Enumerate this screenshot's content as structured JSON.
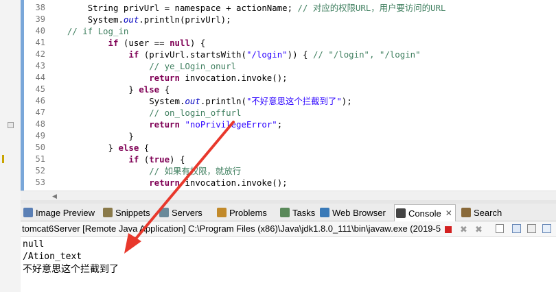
{
  "editor": {
    "line_numbers": [
      "38",
      "39",
      "40",
      "41",
      "42",
      "43",
      "44",
      "45",
      "46",
      "47",
      "48",
      "49",
      "50",
      "51",
      "52",
      "53"
    ],
    "lines": [
      {
        "indent": "        ",
        "parts": [
          [
            "n",
            "String privUrl = namespace + actionName; "
          ],
          [
            "cm",
            "// 对应的权限URL，用户要访问的URL"
          ]
        ]
      },
      {
        "indent": "        ",
        "parts": [
          [
            "n",
            "System."
          ],
          [
            "it",
            "out"
          ],
          [
            "n",
            ".println(privUrl);"
          ]
        ]
      },
      {
        "indent": "    ",
        "parts": [
          [
            "cm",
            "// if Log_in"
          ]
        ]
      },
      {
        "indent": "            ",
        "parts": [
          [
            "kw",
            "if"
          ],
          [
            "n",
            " (user == "
          ],
          [
            "kw",
            "null"
          ],
          [
            "n",
            ") {"
          ]
        ]
      },
      {
        "indent": "                ",
        "parts": [
          [
            "kw",
            "if"
          ],
          [
            "n",
            " (privUrl.startsWith("
          ],
          [
            "st",
            "\"/login\""
          ],
          [
            "n",
            ")) { "
          ],
          [
            "cm",
            "// \"/login\", \"/login\""
          ]
        ]
      },
      {
        "indent": "                    ",
        "parts": [
          [
            "cm",
            "// ye_LOgin_onurl"
          ]
        ]
      },
      {
        "indent": "                    ",
        "parts": [
          [
            "kw",
            "return"
          ],
          [
            "n",
            " invocation.invoke();"
          ]
        ]
      },
      {
        "indent": "                ",
        "parts": [
          [
            "n",
            "} "
          ],
          [
            "kw",
            "else"
          ],
          [
            "n",
            " {"
          ]
        ]
      },
      {
        "indent": "                    ",
        "parts": [
          [
            "n",
            "System."
          ],
          [
            "it",
            "out"
          ],
          [
            "n",
            ".println("
          ],
          [
            "st",
            "\"不好意思这个拦截到了\""
          ],
          [
            "n",
            ");"
          ]
        ]
      },
      {
        "indent": "                    ",
        "parts": [
          [
            "cm",
            "// on_login_offurl"
          ]
        ]
      },
      {
        "indent": "                    ",
        "parts": [
          [
            "kw",
            "return"
          ],
          [
            "n",
            " "
          ],
          [
            "st",
            "\"noPrivilegeError\""
          ],
          [
            "n",
            ";"
          ]
        ]
      },
      {
        "indent": "                ",
        "parts": [
          [
            "n",
            "}"
          ]
        ]
      },
      {
        "indent": "            ",
        "parts": [
          [
            "n",
            "} "
          ],
          [
            "kw",
            "else"
          ],
          [
            "n",
            " {"
          ]
        ]
      },
      {
        "indent": "                ",
        "parts": [
          [
            "kw",
            "if"
          ],
          [
            "n",
            " ("
          ],
          [
            "kw",
            "true"
          ],
          [
            "n",
            ") {"
          ]
        ]
      },
      {
        "indent": "                    ",
        "parts": [
          [
            "cm",
            "// 如果有权限，就放行"
          ]
        ]
      },
      {
        "indent": "                    ",
        "parts": [
          [
            "kw",
            "return"
          ],
          [
            "n",
            " invocation.invoke();"
          ]
        ]
      }
    ]
  },
  "tabs": [
    {
      "label": "Image Preview",
      "icon": "image-preview-icon",
      "color": "#5a7fb5"
    },
    {
      "label": "Snippets",
      "icon": "snippets-icon",
      "color": "#8a7a4a"
    },
    {
      "label": "Servers",
      "icon": "servers-icon",
      "color": "#6a8a9a"
    },
    {
      "label": "Problems",
      "icon": "problems-icon",
      "color": "#c28a2a"
    },
    {
      "label": "Tasks",
      "icon": "tasks-icon",
      "color": "#5a8a5a"
    },
    {
      "label": "Web Browser",
      "icon": "web-browser-icon",
      "color": "#3a7ab8"
    },
    {
      "label": "Console",
      "icon": "console-icon",
      "color": "#444444"
    },
    {
      "label": "Search",
      "icon": "search-icon",
      "color": "#8a6a3a"
    }
  ],
  "console": {
    "launch_title": "tomcat6Server [Remote Java Application] C:\\Program Files (x86)\\Java\\jdk1.8.0_111\\bin\\javaw.exe (2019-5",
    "output": [
      "null",
      "/Ation_text",
      "不好意思这个拦截到了"
    ]
  },
  "annotation": {
    "arrow_color": "#e8382c"
  }
}
